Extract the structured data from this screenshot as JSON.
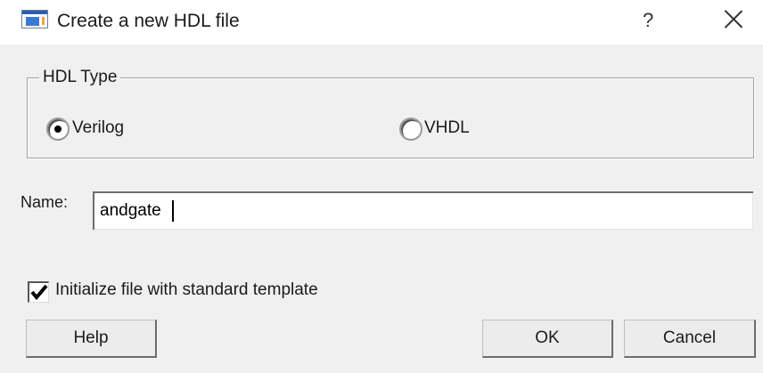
{
  "window": {
    "title": "Create a new HDL file",
    "help_glyph": "?",
    "close_glyph": ""
  },
  "hdl_type": {
    "group_label": "HDL Type",
    "options": [
      {
        "label": "Verilog",
        "selected": true
      },
      {
        "label": "VHDL",
        "selected": false
      }
    ]
  },
  "name": {
    "label": "Name:",
    "value": "andgate",
    "placeholder": ""
  },
  "template_checkbox": {
    "label": "Initialize file with standard template",
    "checked": true
  },
  "buttons": {
    "help": "Help",
    "ok": "OK",
    "cancel": "Cancel"
  }
}
